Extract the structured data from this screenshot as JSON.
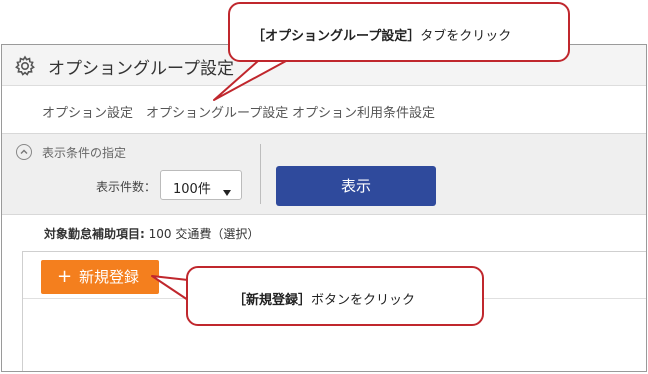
{
  "window": {
    "title": "オプショングループ設定",
    "icon": "gear-icon"
  },
  "tabs": [
    {
      "label": "オプション設定"
    },
    {
      "label": "オプショングループ設定"
    },
    {
      "label": "オプション利用条件設定"
    }
  ],
  "filter": {
    "title": "表示条件の指定",
    "count_label": "表示件数：",
    "count_value": "100件",
    "show_button": "表示"
  },
  "target": {
    "label": "対象勤怠補助項目:",
    "value": "100 交通費（選択）"
  },
  "toolbar": {
    "new_button": "新規登録",
    "new_icon": "plus-icon"
  },
  "callouts": [
    {
      "bold": "［オプショングループ設定］",
      "text": "タブをクリック"
    },
    {
      "bold": "［新規登録］",
      "text": "ボタンをクリック"
    }
  ],
  "colors": {
    "accent_blue": "#2f4a9c",
    "accent_orange": "#f47f1e",
    "callout_border": "#c0272d"
  }
}
